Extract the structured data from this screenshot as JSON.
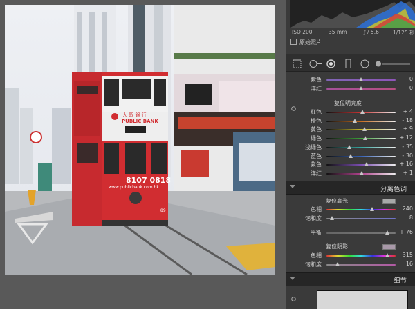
{
  "exif": {
    "iso": "ISO 200",
    "focal": "35 mm",
    "aperture": "ƒ / 5.6",
    "shutter": "1/125 秒"
  },
  "original_photo_label": "原始照片",
  "colors": {
    "panel_bg": "#3a3a3a",
    "header_bg": "#262626",
    "canvas_bg": "#595959",
    "thumb": "#c8c8c8"
  },
  "hsl_top_rows": [
    {
      "label": "紫色",
      "value": "0",
      "position": 0.5,
      "gradient": "linear-gradient(90deg,#7f65b5,#8e55b8)"
    },
    {
      "label": "洋红",
      "value": "0",
      "position": 0.5,
      "gradient": "linear-gradient(90deg,#a5519a,#b74f80)"
    }
  ],
  "luminance_group_label": "复位明亮度",
  "luminance_rows": [
    {
      "label": "红色",
      "value": "+ 4",
      "position": 0.52,
      "gradient": "linear-gradient(90deg,#111,#c33,#eee)"
    },
    {
      "label": "橙色",
      "value": "- 18",
      "position": 0.41,
      "gradient": "linear-gradient(90deg,#111,#c76b1f,#eee)"
    },
    {
      "label": "黄色",
      "value": "+ 9",
      "position": 0.545,
      "gradient": "linear-gradient(90deg,#111,#c6b62a,#eee)"
    },
    {
      "label": "绿色",
      "value": "+ 12",
      "position": 0.56,
      "gradient": "linear-gradient(90deg,#111,#3da23a,#eee)"
    },
    {
      "label": "浅绿色",
      "value": "- 35",
      "position": 0.325,
      "gradient": "linear-gradient(90deg,#111,#35a7a0,#eee)"
    },
    {
      "label": "蓝色",
      "value": "- 30",
      "position": 0.35,
      "gradient": "linear-gradient(90deg,#111,#3561b6,#eee)"
    },
    {
      "label": "紫色",
      "value": "+ 16",
      "position": 0.58,
      "gradient": "linear-gradient(90deg,#111,#7c4fb3,#eee)"
    },
    {
      "label": "洋红",
      "value": "+ 1",
      "position": 0.505,
      "gradient": "linear-gradient(90deg,#111,#b2438e,#eee)"
    }
  ],
  "split_toning": {
    "title": "分离色调",
    "highlights_label": "复位高光",
    "highlights": [
      {
        "label": "色相",
        "value": "240",
        "position": 0.66,
        "gradient": "linear-gradient(90deg,#d33,#dd3,#3d3,#3dd,#33d,#d3d,#d33)"
      },
      {
        "label": "饱和度",
        "value": "8",
        "position": 0.08,
        "gradient": "linear-gradient(90deg,#888,#6f72c9)"
      }
    ],
    "balance_label": "平衡",
    "balance_value": "+ 76",
    "balance_position": 0.88,
    "shadows_label": "复位阴影",
    "shadows": [
      {
        "label": "色相",
        "value": "315",
        "position": 0.875,
        "gradient": "linear-gradient(90deg,#d33,#dd3,#3d3,#3dd,#33d,#d3d,#d33)"
      },
      {
        "label": "饱和度",
        "value": "16",
        "position": 0.16,
        "gradient": "linear-gradient(90deg,#888,#b35aa5)"
      }
    ]
  },
  "detail_section_title": "细节",
  "photo_signs": {
    "bank_cn": "大 眾 銀 行",
    "bank_en": "PUBLIC BANK",
    "phone": "8107 0818",
    "website": "www.publicbank.com.hk",
    "route": "89"
  }
}
